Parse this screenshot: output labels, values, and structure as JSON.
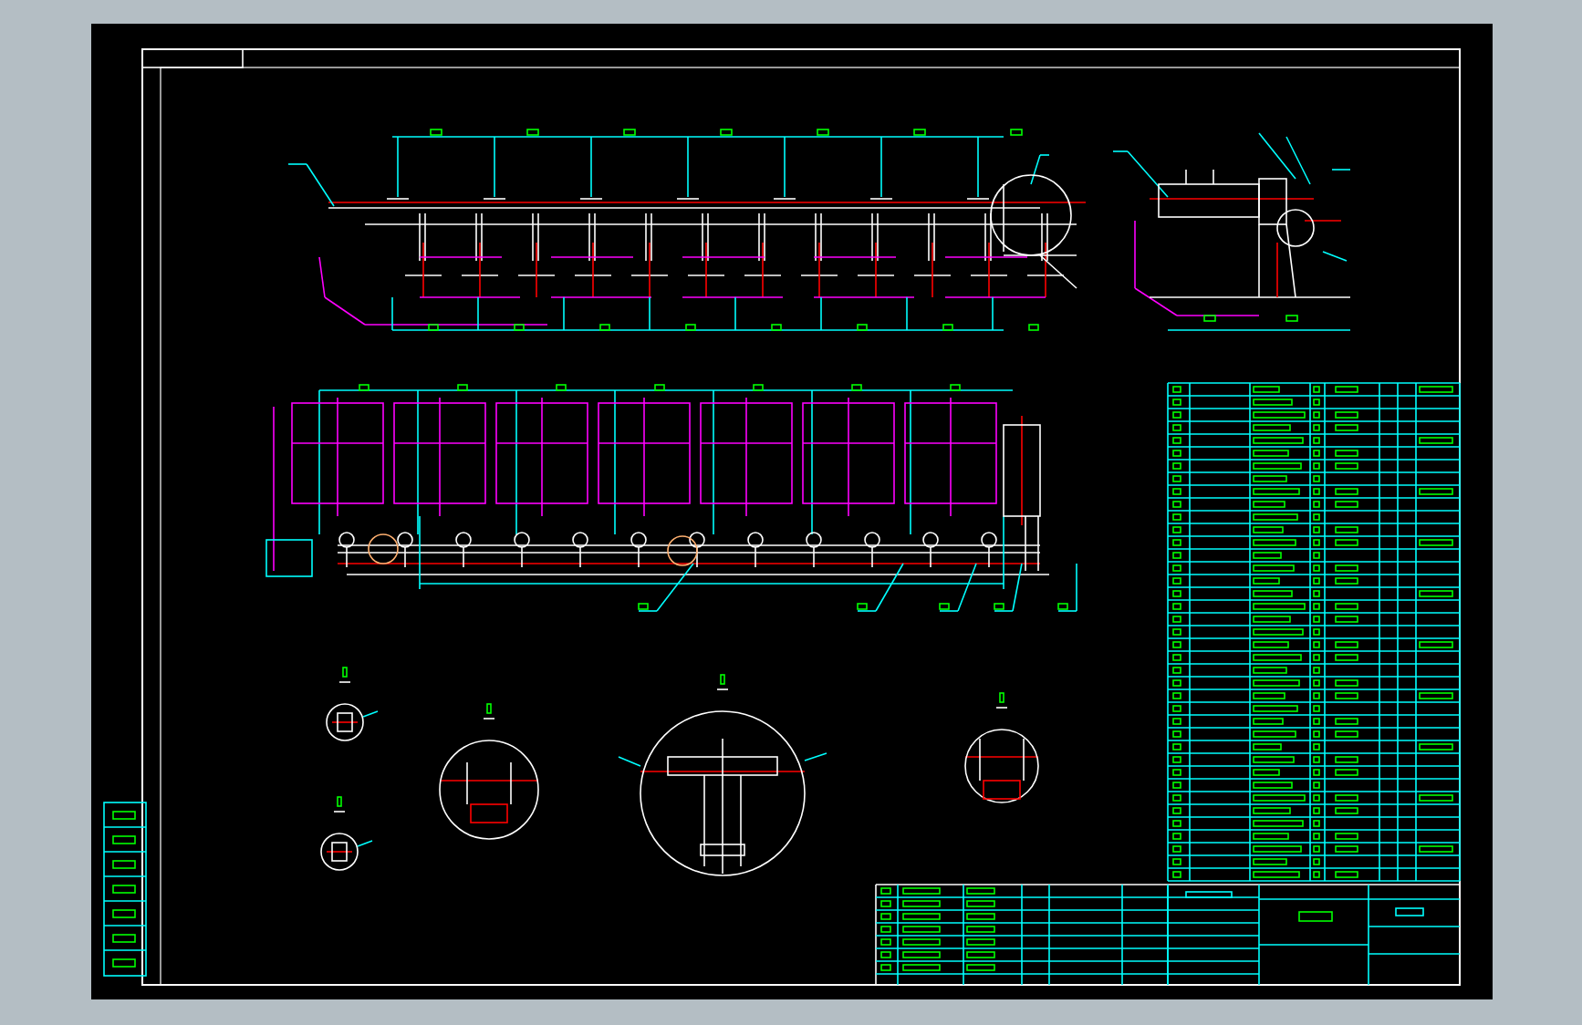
{
  "drawing_sheet": {
    "views": [
      {
        "kind": "elevation"
      },
      {
        "kind": "end-view"
      },
      {
        "kind": "plan"
      },
      {
        "kind": "detail"
      },
      {
        "kind": "detail"
      },
      {
        "kind": "detail"
      },
      {
        "kind": "detail"
      },
      {
        "kind": "detail"
      },
      {
        "kind": "parts-list"
      },
      {
        "kind": "title-block"
      },
      {
        "kind": "revision-strip"
      }
    ]
  }
}
